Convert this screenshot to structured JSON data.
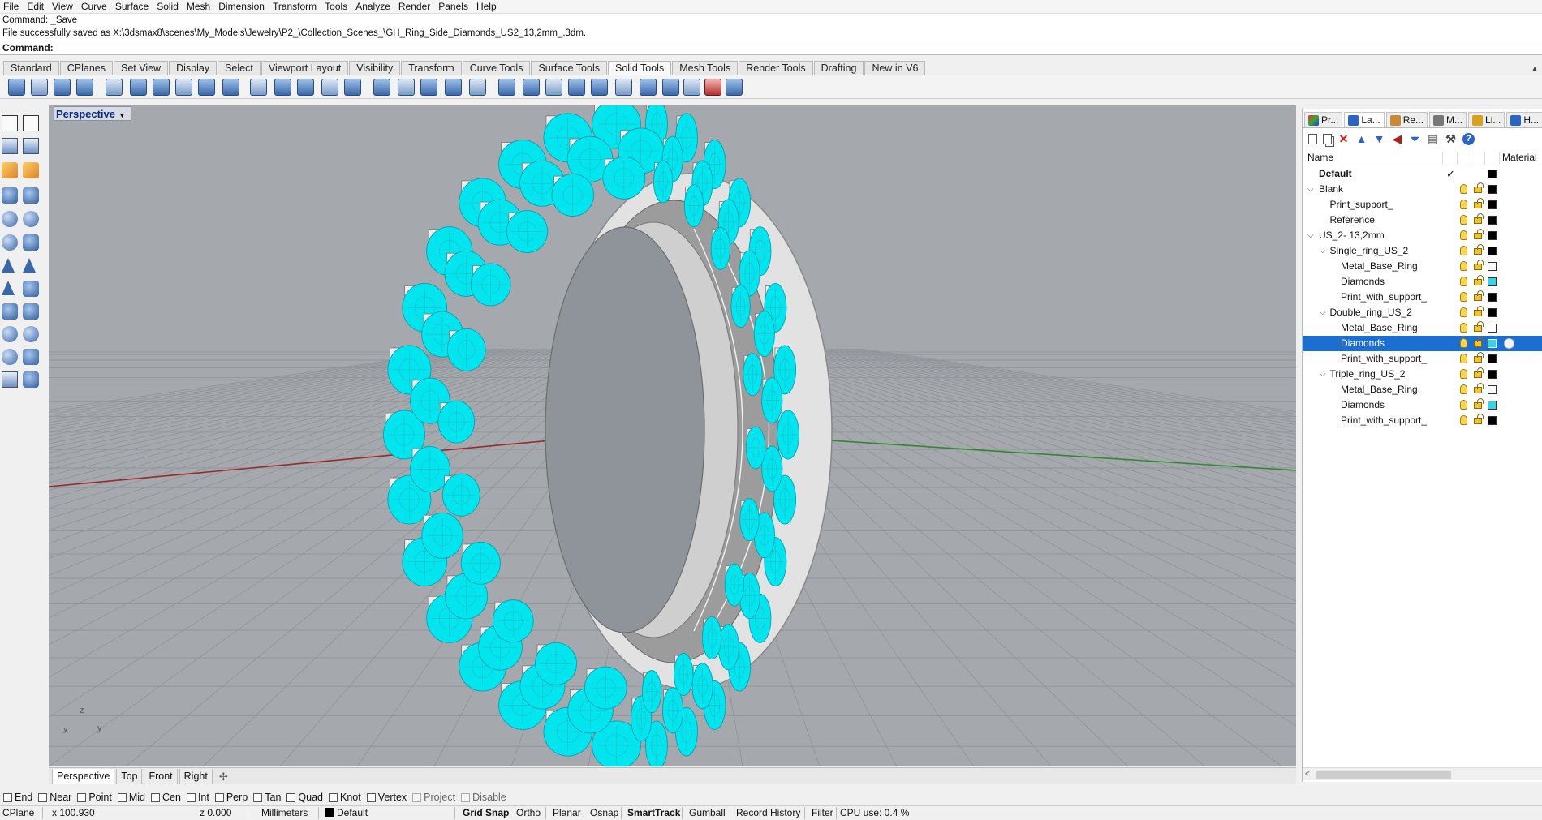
{
  "menu": [
    "File",
    "Edit",
    "View",
    "Curve",
    "Surface",
    "Solid",
    "Mesh",
    "Dimension",
    "Transform",
    "Tools",
    "Analyze",
    "Render",
    "Panels",
    "Help"
  ],
  "command_history": [
    "Command: _Save",
    "File successfully saved as X:\\3dsmax8\\scenes\\My_Models\\Jewelry\\P2_\\Collection_Scenes_\\GH_Ring_Side_Diamonds_US2_13,2mm_.3dm."
  ],
  "command_prompt": "Command:",
  "command_value": "",
  "toolbar_tabs": [
    {
      "label": "Standard",
      "active": false
    },
    {
      "label": "CPlanes",
      "active": false
    },
    {
      "label": "Set View",
      "active": false
    },
    {
      "label": "Display",
      "active": false
    },
    {
      "label": "Select",
      "active": false
    },
    {
      "label": "Viewport Layout",
      "active": false
    },
    {
      "label": "Visibility",
      "active": false
    },
    {
      "label": "Transform",
      "active": false
    },
    {
      "label": "Curve Tools",
      "active": false
    },
    {
      "label": "Surface Tools",
      "active": false
    },
    {
      "label": "Solid Tools",
      "active": true
    },
    {
      "label": "Mesh Tools",
      "active": false
    },
    {
      "label": "Render Tools",
      "active": false
    },
    {
      "label": "Drafting",
      "active": false
    },
    {
      "label": "New in V6",
      "active": false
    }
  ],
  "viewport": {
    "title": "Perspective",
    "axis_y": "y",
    "axis_z": "z",
    "axis_x": "x",
    "tabs": [
      {
        "label": "Perspective",
        "active": true
      },
      {
        "label": "Top",
        "active": false
      },
      {
        "label": "Front",
        "active": false
      },
      {
        "label": "Right",
        "active": false
      }
    ],
    "add_tab": "✢",
    "colors": {
      "background": "#a5a8ad",
      "grid": "#8f949a",
      "x_axis": "#9b2a2a",
      "y_axis": "#2e8a2e",
      "diamond": "#00e5ee",
      "metal": "#eeeeee"
    }
  },
  "panel": {
    "tabs": [
      {
        "label": "Pr...",
        "icon": "properties-icon",
        "active": false
      },
      {
        "label": "La...",
        "icon": "layers-icon",
        "active": true
      },
      {
        "label": "Re...",
        "icon": "render-icon",
        "active": false
      },
      {
        "label": "M...",
        "icon": "materials-icon",
        "active": false
      },
      {
        "label": "Li...",
        "icon": "libraries-icon",
        "active": false
      },
      {
        "label": "H...",
        "icon": "help-icon",
        "active": false
      }
    ],
    "col_name": "Name",
    "col_material": "Material",
    "layers": [
      {
        "name": "Default",
        "indent": 0,
        "expander": "",
        "bold": true,
        "current": true,
        "color": "#000000",
        "selected": false
      },
      {
        "name": "Blank",
        "indent": 0,
        "expander": "⌄",
        "bold": false,
        "current": false,
        "color": "#000000",
        "selected": false
      },
      {
        "name": "Print_support_",
        "indent": 1,
        "expander": "",
        "bold": false,
        "current": false,
        "color": "#000000",
        "selected": false
      },
      {
        "name": "Reference",
        "indent": 1,
        "expander": "",
        "bold": false,
        "current": false,
        "color": "#000000",
        "selected": false
      },
      {
        "name": "US_2- 13,2mm",
        "indent": 0,
        "expander": "⌄",
        "bold": false,
        "current": false,
        "color": "#000000",
        "selected": false
      },
      {
        "name": "Single_ring_US_2",
        "indent": 1,
        "expander": "⌄",
        "bold": false,
        "current": false,
        "color": "#000000",
        "selected": false
      },
      {
        "name": "Metal_Base_Ring",
        "indent": 2,
        "expander": "",
        "bold": false,
        "current": false,
        "color": "#ffffff",
        "selected": false
      },
      {
        "name": "Diamonds",
        "indent": 2,
        "expander": "",
        "bold": false,
        "current": false,
        "color": "#2fd6e6",
        "selected": false
      },
      {
        "name": "Print_with_support_",
        "indent": 2,
        "expander": "",
        "bold": false,
        "current": false,
        "color": "#000000",
        "selected": false
      },
      {
        "name": "Double_ring_US_2",
        "indent": 1,
        "expander": "⌄",
        "bold": false,
        "current": false,
        "color": "#000000",
        "selected": false
      },
      {
        "name": "Metal_Base_Ring",
        "indent": 2,
        "expander": "",
        "bold": false,
        "current": false,
        "color": "#ffffff",
        "selected": false
      },
      {
        "name": "Diamonds",
        "indent": 2,
        "expander": "",
        "bold": false,
        "current": false,
        "color": "#2fd6e6",
        "selected": true
      },
      {
        "name": "Print_with_support_",
        "indent": 2,
        "expander": "",
        "bold": false,
        "current": false,
        "color": "#000000",
        "selected": false
      },
      {
        "name": "Triple_ring_US_2",
        "indent": 1,
        "expander": "⌄",
        "bold": false,
        "current": false,
        "color": "#000000",
        "selected": false
      },
      {
        "name": "Metal_Base_Ring",
        "indent": 2,
        "expander": "",
        "bold": false,
        "current": false,
        "color": "#ffffff",
        "selected": false
      },
      {
        "name": "Diamonds",
        "indent": 2,
        "expander": "",
        "bold": false,
        "current": false,
        "color": "#2fd6e6",
        "selected": false
      },
      {
        "name": "Print_with_support_",
        "indent": 2,
        "expander": "",
        "bold": false,
        "current": false,
        "color": "#000000",
        "selected": false
      }
    ],
    "selection_color": "#1c6fd1"
  },
  "osnaps": [
    {
      "label": "End",
      "enabled": true
    },
    {
      "label": "Near",
      "enabled": true
    },
    {
      "label": "Point",
      "enabled": true
    },
    {
      "label": "Mid",
      "enabled": true
    },
    {
      "label": "Cen",
      "enabled": true
    },
    {
      "label": "Int",
      "enabled": true
    },
    {
      "label": "Perp",
      "enabled": true
    },
    {
      "label": "Tan",
      "enabled": true
    },
    {
      "label": "Quad",
      "enabled": true
    },
    {
      "label": "Knot",
      "enabled": true
    },
    {
      "label": "Vertex",
      "enabled": true
    },
    {
      "label": "Project",
      "enabled": false
    },
    {
      "label": "Disable",
      "enabled": false
    }
  ],
  "status": {
    "cplane": "CPlane",
    "x": "x 100.930",
    "z": "z 0.000",
    "units": "Millimeters",
    "layer": "Default",
    "grid_snap": "Grid Snap",
    "ortho": "Ortho",
    "planar": "Planar",
    "osnap": "Osnap",
    "smarttrack": "SmartTrack",
    "gumball": "Gumball",
    "record_history": "Record History",
    "filter": "Filter",
    "cpu": "CPU use: 0.4 %"
  }
}
